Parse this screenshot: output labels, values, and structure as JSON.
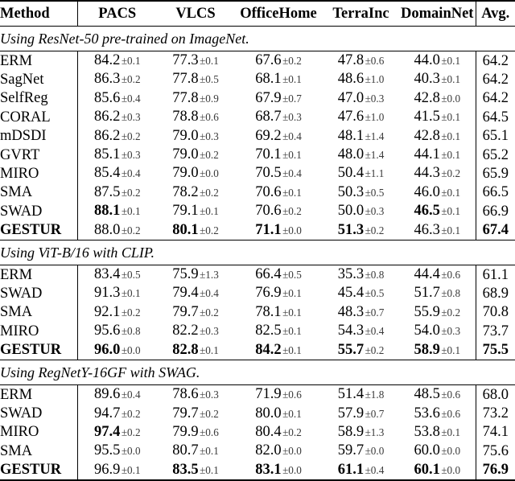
{
  "table": {
    "columns": [
      {
        "key": "method",
        "label": "Method"
      },
      {
        "key": "pacs",
        "label": "PACS"
      },
      {
        "key": "vlcs",
        "label": "VLCS"
      },
      {
        "key": "officehome",
        "label": "OfficeHome"
      },
      {
        "key": "terrainc",
        "label": "TerraInc"
      },
      {
        "key": "domainnet",
        "label": "DomainNet"
      },
      {
        "key": "avg",
        "label": "Avg."
      }
    ],
    "sections": [
      {
        "caption": "Using ResNet-50 pre-trained on ImageNet.",
        "rows": [
          {
            "method": "ERM",
            "method_bold": false,
            "cells": [
              {
                "value": "84.2",
                "err": "±0.1",
                "bold": false
              },
              {
                "value": "77.3",
                "err": "±0.1",
                "bold": false
              },
              {
                "value": "67.6",
                "err": "±0.2",
                "bold": false
              },
              {
                "value": "47.8",
                "err": "±0.6",
                "bold": false
              },
              {
                "value": "44.0",
                "err": "±0.1",
                "bold": false
              }
            ],
            "avg": {
              "value": "64.2",
              "bold": false
            }
          },
          {
            "method": "SagNet",
            "method_bold": false,
            "cells": [
              {
                "value": "86.3",
                "err": "±0.2",
                "bold": false
              },
              {
                "value": "77.8",
                "err": "±0.5",
                "bold": false
              },
              {
                "value": "68.1",
                "err": "±0.1",
                "bold": false
              },
              {
                "value": "48.6",
                "err": "±1.0",
                "bold": false
              },
              {
                "value": "40.3",
                "err": "±0.1",
                "bold": false
              }
            ],
            "avg": {
              "value": "64.2",
              "bold": false
            }
          },
          {
            "method": "SelfReg",
            "method_bold": false,
            "cells": [
              {
                "value": "85.6",
                "err": "±0.4",
                "bold": false
              },
              {
                "value": "77.8",
                "err": "±0.9",
                "bold": false
              },
              {
                "value": "67.9",
                "err": "±0.7",
                "bold": false
              },
              {
                "value": "47.0",
                "err": "±0.3",
                "bold": false
              },
              {
                "value": "42.8",
                "err": "±0.0",
                "bold": false
              }
            ],
            "avg": {
              "value": "64.2",
              "bold": false
            }
          },
          {
            "method": "CORAL",
            "method_bold": false,
            "cells": [
              {
                "value": "86.2",
                "err": "±0.3",
                "bold": false
              },
              {
                "value": "78.8",
                "err": "±0.6",
                "bold": false
              },
              {
                "value": "68.7",
                "err": "±0.3",
                "bold": false
              },
              {
                "value": "47.6",
                "err": "±1.0",
                "bold": false
              },
              {
                "value": "41.5",
                "err": "±0.1",
                "bold": false
              }
            ],
            "avg": {
              "value": "64.5",
              "bold": false
            }
          },
          {
            "method": "mDSDI",
            "method_bold": false,
            "cells": [
              {
                "value": "86.2",
                "err": "±0.2",
                "bold": false
              },
              {
                "value": "79.0",
                "err": "±0.3",
                "bold": false
              },
              {
                "value": "69.2",
                "err": "±0.4",
                "bold": false
              },
              {
                "value": "48.1",
                "err": "±1.4",
                "bold": false
              },
              {
                "value": "42.8",
                "err": "±0.1",
                "bold": false
              }
            ],
            "avg": {
              "value": "65.1",
              "bold": false
            }
          },
          {
            "method": "GVRT",
            "method_bold": false,
            "cells": [
              {
                "value": "85.1",
                "err": "±0.3",
                "bold": false
              },
              {
                "value": "79.0",
                "err": "±0.2",
                "bold": false
              },
              {
                "value": "70.1",
                "err": "±0.1",
                "bold": false
              },
              {
                "value": "48.0",
                "err": "±1.4",
                "bold": false
              },
              {
                "value": "44.1",
                "err": "±0.1",
                "bold": false
              }
            ],
            "avg": {
              "value": "65.2",
              "bold": false
            }
          },
          {
            "method": "MIRO",
            "method_bold": false,
            "cells": [
              {
                "value": "85.4",
                "err": "±0.4",
                "bold": false
              },
              {
                "value": "79.0",
                "err": "±0.0",
                "bold": false
              },
              {
                "value": "70.5",
                "err": "±0.4",
                "bold": false
              },
              {
                "value": "50.4",
                "err": "±1.1",
                "bold": false
              },
              {
                "value": "44.3",
                "err": "±0.2",
                "bold": false
              }
            ],
            "avg": {
              "value": "65.9",
              "bold": false
            }
          },
          {
            "method": "SMA",
            "method_bold": false,
            "cells": [
              {
                "value": "87.5",
                "err": "±0.2",
                "bold": false
              },
              {
                "value": "78.2",
                "err": "±0.2",
                "bold": false
              },
              {
                "value": "70.6",
                "err": "±0.1",
                "bold": false
              },
              {
                "value": "50.3",
                "err": "±0.5",
                "bold": false
              },
              {
                "value": "46.0",
                "err": "±0.1",
                "bold": false
              }
            ],
            "avg": {
              "value": "66.5",
              "bold": false
            }
          },
          {
            "method": "SWAD",
            "method_bold": false,
            "cells": [
              {
                "value": "88.1",
                "err": "±0.1",
                "bold": true
              },
              {
                "value": "79.1",
                "err": "±0.1",
                "bold": false
              },
              {
                "value": "70.6",
                "err": "±0.2",
                "bold": false
              },
              {
                "value": "50.0",
                "err": "±0.3",
                "bold": false
              },
              {
                "value": "46.5",
                "err": "±0.1",
                "bold": true
              }
            ],
            "avg": {
              "value": "66.9",
              "bold": false
            }
          },
          {
            "method": "GESTUR",
            "method_bold": true,
            "cells": [
              {
                "value": "88.0",
                "err": "±0.2",
                "bold": false
              },
              {
                "value": "80.1",
                "err": "±0.2",
                "bold": true
              },
              {
                "value": "71.1",
                "err": "±0.0",
                "bold": true
              },
              {
                "value": "51.3",
                "err": "±0.2",
                "bold": true
              },
              {
                "value": "46.3",
                "err": "±0.1",
                "bold": false
              }
            ],
            "avg": {
              "value": "67.4",
              "bold": true
            }
          }
        ]
      },
      {
        "caption": "Using ViT-B/16 with CLIP.",
        "rows": [
          {
            "method": "ERM",
            "method_bold": false,
            "cells": [
              {
                "value": "83.4",
                "err": "±0.5",
                "bold": false
              },
              {
                "value": "75.9",
                "err": "±1.3",
                "bold": false
              },
              {
                "value": "66.4",
                "err": "±0.5",
                "bold": false
              },
              {
                "value": "35.3",
                "err": "±0.8",
                "bold": false
              },
              {
                "value": "44.4",
                "err": "±0.6",
                "bold": false
              }
            ],
            "avg": {
              "value": "61.1",
              "bold": false
            }
          },
          {
            "method": "SWAD",
            "method_bold": false,
            "cells": [
              {
                "value": "91.3",
                "err": "±0.1",
                "bold": false
              },
              {
                "value": "79.4",
                "err": "±0.4",
                "bold": false
              },
              {
                "value": "76.9",
                "err": "±0.1",
                "bold": false
              },
              {
                "value": "45.4",
                "err": "±0.5",
                "bold": false
              },
              {
                "value": "51.7",
                "err": "±0.8",
                "bold": false
              }
            ],
            "avg": {
              "value": "68.9",
              "bold": false
            }
          },
          {
            "method": "SMA",
            "method_bold": false,
            "cells": [
              {
                "value": "92.1",
                "err": "±0.2",
                "bold": false
              },
              {
                "value": "79.7",
                "err": "±0.2",
                "bold": false
              },
              {
                "value": "78.1",
                "err": "±0.1",
                "bold": false
              },
              {
                "value": "48.3",
                "err": "±0.7",
                "bold": false
              },
              {
                "value": "55.9",
                "err": "±0.2",
                "bold": false
              }
            ],
            "avg": {
              "value": "70.8",
              "bold": false
            }
          },
          {
            "method": "MIRO",
            "method_bold": false,
            "cells": [
              {
                "value": "95.6",
                "err": "±0.8",
                "bold": false
              },
              {
                "value": "82.2",
                "err": "±0.3",
                "bold": false
              },
              {
                "value": "82.5",
                "err": "±0.1",
                "bold": false
              },
              {
                "value": "54.3",
                "err": "±0.4",
                "bold": false
              },
              {
                "value": "54.0",
                "err": "±0.3",
                "bold": false
              }
            ],
            "avg": {
              "value": "73.7",
              "bold": false
            }
          },
          {
            "method": "GESTUR",
            "method_bold": true,
            "cells": [
              {
                "value": "96.0",
                "err": "±0.0",
                "bold": true
              },
              {
                "value": "82.8",
                "err": "±0.1",
                "bold": true
              },
              {
                "value": "84.2",
                "err": "±0.1",
                "bold": true
              },
              {
                "value": "55.7",
                "err": "±0.2",
                "bold": true
              },
              {
                "value": "58.9",
                "err": "±0.1",
                "bold": true
              }
            ],
            "avg": {
              "value": "75.5",
              "bold": true
            }
          }
        ]
      },
      {
        "caption": "Using RegNetY-16GF with SWAG.",
        "rows": [
          {
            "method": "ERM",
            "method_bold": false,
            "cells": [
              {
                "value": "89.6",
                "err": "±0.4",
                "bold": false
              },
              {
                "value": "78.6",
                "err": "±0.3",
                "bold": false
              },
              {
                "value": "71.9",
                "err": "±0.6",
                "bold": false
              },
              {
                "value": "51.4",
                "err": "±1.8",
                "bold": false
              },
              {
                "value": "48.5",
                "err": "±0.6",
                "bold": false
              }
            ],
            "avg": {
              "value": "68.0",
              "bold": false
            }
          },
          {
            "method": "SWAD",
            "method_bold": false,
            "cells": [
              {
                "value": "94.7",
                "err": "±0.2",
                "bold": false
              },
              {
                "value": "79.7",
                "err": "±0.2",
                "bold": false
              },
              {
                "value": "80.0",
                "err": "±0.1",
                "bold": false
              },
              {
                "value": "57.9",
                "err": "±0.7",
                "bold": false
              },
              {
                "value": "53.6",
                "err": "±0.6",
                "bold": false
              }
            ],
            "avg": {
              "value": "73.2",
              "bold": false
            }
          },
          {
            "method": "MIRO",
            "method_bold": false,
            "cells": [
              {
                "value": "97.4",
                "err": "±0.2",
                "bold": true
              },
              {
                "value": "79.9",
                "err": "±0.6",
                "bold": false
              },
              {
                "value": "80.4",
                "err": "±0.2",
                "bold": false
              },
              {
                "value": "58.9",
                "err": "±1.3",
                "bold": false
              },
              {
                "value": "53.8",
                "err": "±0.1",
                "bold": false
              }
            ],
            "avg": {
              "value": "74.1",
              "bold": false
            }
          },
          {
            "method": "SMA",
            "method_bold": false,
            "cells": [
              {
                "value": "95.5",
                "err": "±0.0",
                "bold": false
              },
              {
                "value": "80.7",
                "err": "±0.1",
                "bold": false
              },
              {
                "value": "82.0",
                "err": "±0.0",
                "bold": false
              },
              {
                "value": "59.7",
                "err": "±0.0",
                "bold": false
              },
              {
                "value": "60.0",
                "err": "±0.0",
                "bold": false
              }
            ],
            "avg": {
              "value": "75.6",
              "bold": false
            }
          },
          {
            "method": "GESTUR",
            "method_bold": true,
            "cells": [
              {
                "value": "96.9",
                "err": "±0.1",
                "bold": false
              },
              {
                "value": "83.5",
                "err": "±0.1",
                "bold": true
              },
              {
                "value": "83.1",
                "err": "±0.0",
                "bold": true
              },
              {
                "value": "61.1",
                "err": "±0.4",
                "bold": true
              },
              {
                "value": "60.1",
                "err": "±0.0",
                "bold": true
              }
            ],
            "avg": {
              "value": "76.9",
              "bold": true
            }
          }
        ]
      }
    ]
  }
}
